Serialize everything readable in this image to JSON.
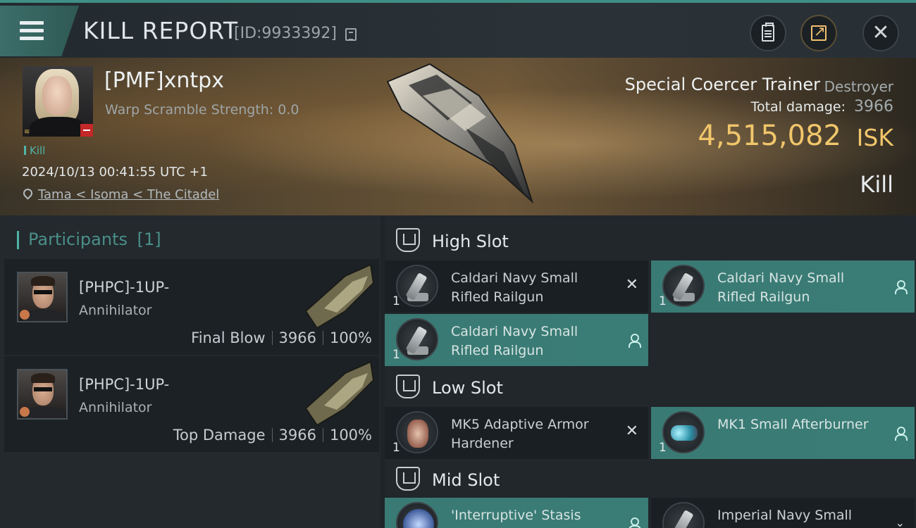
{
  "header": {
    "title": "KILL REPORT",
    "report_id": "[ID:9933392]",
    "icons": [
      "menu-icon",
      "copy-icon",
      "clipboard-icon",
      "share-icon",
      "close-icon"
    ]
  },
  "victim": {
    "name": "[PMF]xntpx",
    "warp_scramble": "Warp Scramble Strength: 0.0",
    "kill_tag": "Kill",
    "timestamp": "2024/10/13 00:41:55 UTC +1",
    "location": "Tama < Isoma < The Citadel",
    "ship_name": "Special Coercer Trainer",
    "ship_class": "Destroyer",
    "total_damage_label": "Total damage:",
    "total_damage": "3966",
    "isk_value": "4,515,082",
    "isk_unit": "ISK",
    "result": "Kill"
  },
  "participants": {
    "title": "Participants",
    "count": "[1]",
    "items": [
      {
        "name": "[PHPC]-1UP-",
        "ship": "Annihilator",
        "role": "Final Blow",
        "damage": "3966",
        "percent": "100%"
      },
      {
        "name": "[PHPC]-1UP-",
        "ship": "Annihilator",
        "role": "Top Damage",
        "damage": "3966",
        "percent": "100%"
      }
    ]
  },
  "slots": {
    "high": {
      "label": "High Slot",
      "modules": [
        {
          "qty": "1",
          "name": "Caldari Navy Small Rifled Railgun",
          "state": "destroyed"
        },
        {
          "qty": "1",
          "name": "Caldari Navy Small Rifled Railgun",
          "state": "dropped"
        },
        {
          "qty": "1",
          "name": "Caldari Navy Small Rifled Railgun",
          "state": "dropped"
        }
      ]
    },
    "low": {
      "label": "Low Slot",
      "modules": [
        {
          "qty": "1",
          "name": "MK5 Adaptive Armor Hardener",
          "state": "destroyed"
        },
        {
          "qty": "1",
          "name": "MK1 Small Afterburner",
          "state": "dropped"
        }
      ]
    },
    "mid": {
      "label": "Mid Slot",
      "modules": [
        {
          "qty": "",
          "name": "'Interruptive' Stasis",
          "state": "dropped"
        },
        {
          "qty": "",
          "name": "Imperial Navy Small",
          "state": "destroyed"
        }
      ]
    }
  },
  "colors": {
    "accent": "#4fb3a8",
    "fitted_module": "#3a7a74",
    "isk": "#f1c66b",
    "status_red": "#c42828"
  }
}
